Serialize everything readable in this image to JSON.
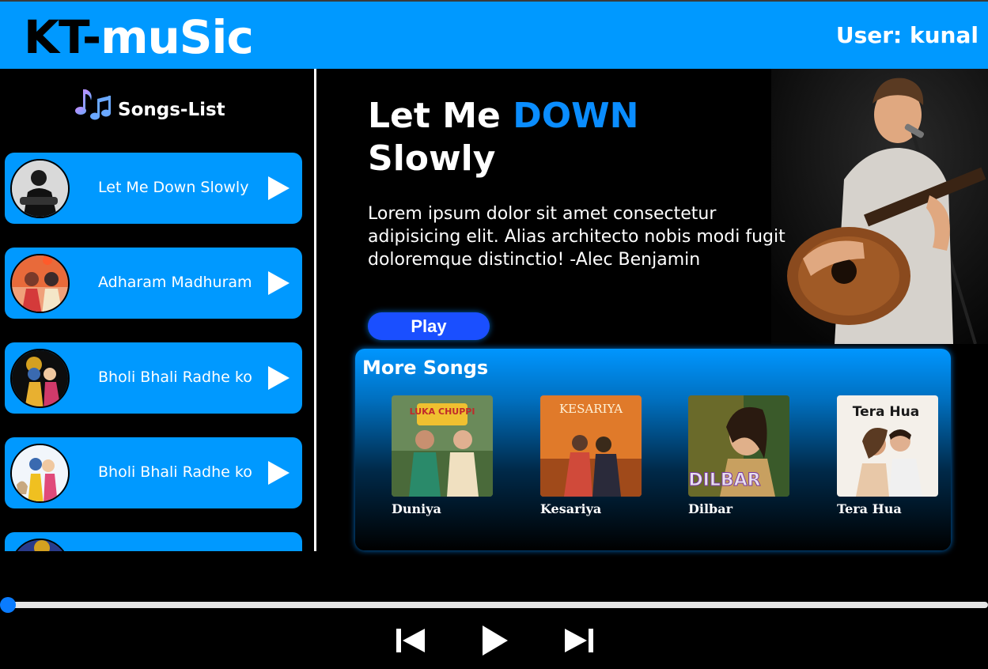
{
  "header": {
    "logo_part1": "KT-",
    "logo_part2": "muSic",
    "user_label": "User: kunal",
    "bg_color": "#0099ff"
  },
  "sidebar": {
    "title": "Songs-List",
    "icon": "music-notes-icon",
    "items": [
      {
        "label": "Let Me Down Slowly"
      },
      {
        "label": "Adharam Madhuram"
      },
      {
        "label": "Bholi Bhali Radhe ko"
      },
      {
        "label": "Bholi Bhali Radhe ko"
      },
      {
        "label": ""
      }
    ]
  },
  "hero": {
    "title_a": "Let Me",
    "title_accent": "DOWN",
    "title_b": "Slowly",
    "description": "Lorem ipsum dolor sit amet consectetur adipisicing elit. Alias architecto nobis modi fugit doloremque distinctio! -Alec Benjamin",
    "play_label": "Play",
    "accent_color": "#0a8dff"
  },
  "more_songs": {
    "title": "More Songs",
    "cards": [
      {
        "label": "Duniya",
        "cover_text": "LUKA CHUPPI"
      },
      {
        "label": "Kesariya",
        "cover_text": "KESARIYA"
      },
      {
        "label": "Dilbar",
        "cover_text": "DILBAR"
      },
      {
        "label": "Tera Hua",
        "cover_text": "Tera Hua"
      }
    ]
  },
  "player": {
    "progress": 0,
    "controls": [
      "previous-icon",
      "play-icon",
      "next-icon"
    ]
  }
}
